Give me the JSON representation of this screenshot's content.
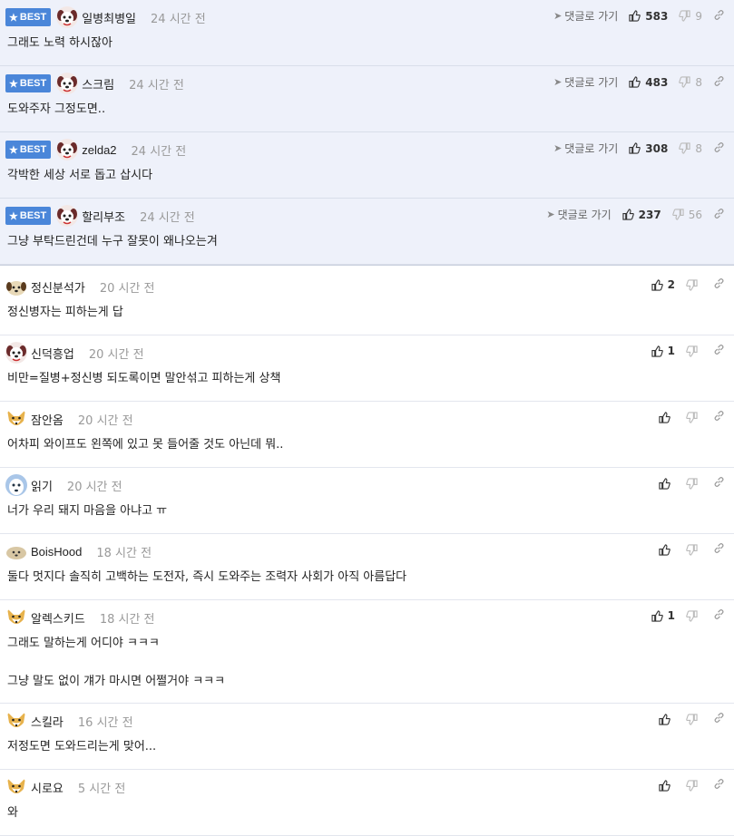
{
  "best_comments": [
    {
      "badge": "BEST",
      "nick": "일병최병일",
      "time": "24 시간 전",
      "text": [
        "그래도 노력 하시잖아"
      ],
      "goto": "댓글로 가기",
      "up": "583",
      "down": "9",
      "avatar": "dog-red"
    },
    {
      "badge": "BEST",
      "nick": "스크림",
      "time": "24 시간 전",
      "text": [
        "도와주자 그정도면.."
      ],
      "goto": "댓글로 가기",
      "up": "483",
      "down": "8",
      "avatar": "dog-red"
    },
    {
      "badge": "BEST",
      "nick": "zelda2",
      "time": "24 시간 전",
      "text": [
        "각박한 세상 서로 돕고 삽시다"
      ],
      "goto": "댓글로 가기",
      "up": "308",
      "down": "8",
      "avatar": "dog-red"
    },
    {
      "badge": "BEST",
      "nick": "할리부조",
      "time": "24 시간 전",
      "text": [
        "그냥 부탁드린건데 누구 잘못이 왜나오는겨"
      ],
      "goto": "댓글로 가기",
      "up": "237",
      "down": "56",
      "avatar": "dog-red"
    }
  ],
  "comments": [
    {
      "nick": "정신분석가",
      "time": "20 시간 전",
      "text": [
        "정신병자는 피하는게 답"
      ],
      "up": "2",
      "avatar": "dog-face"
    },
    {
      "nick": "신덕흥업",
      "time": "20 시간 전",
      "text": [
        "비만=질병+정신병 되도록이면 말안섞고 피하는게 상책"
      ],
      "up": "1",
      "avatar": "dog-red"
    },
    {
      "nick": "잠안옴",
      "time": "20 시간 전",
      "text": [
        "어차피 와이프도 왼쪽에 있고 못 들어줄 것도 아닌데 뭐.."
      ],
      "up": "",
      "avatar": "fox"
    },
    {
      "nick": "읽기",
      "time": "20 시간 전",
      "text": [
        "너가 우리 돼지 마음을 아냐고 ㅠ"
      ],
      "up": "",
      "avatar": "ghost"
    },
    {
      "nick": "BoisHood",
      "time": "18 시간 전",
      "text": [
        "둘다 멋지다 솔직히 고백하는 도전자, 즉시 도와주는 조력자 사회가 아직 아름답다"
      ],
      "up": "",
      "avatar": "puppy"
    },
    {
      "nick": "알렉스키드",
      "time": "18 시간 전",
      "text": [
        "그래도 말하는게 어디야 ㅋㅋㅋ",
        "그냥 말도 없이 걔가 마시면 어쩔거야 ㅋㅋㅋ"
      ],
      "up": "1",
      "avatar": "fox"
    },
    {
      "nick": "스킬라",
      "time": "16 시간 전",
      "text": [
        "저정도면 도와드리는게 맞어..."
      ],
      "up": "",
      "avatar": "fox"
    },
    {
      "nick": "시로요",
      "time": "5 시간 전",
      "text": [
        "와"
      ],
      "up": "",
      "avatar": "fox"
    }
  ],
  "colors": {
    "best_bg": "#eef1fa",
    "badge": "#4a86d9",
    "time": "#999999"
  }
}
